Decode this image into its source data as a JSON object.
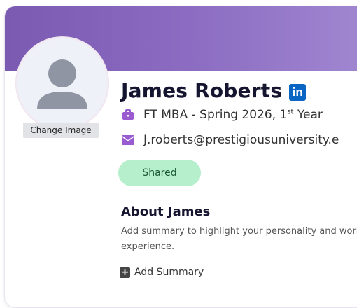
{
  "profile": {
    "name": "James Roberts",
    "linkedin_label": "in",
    "program": "FT MBA - Spring 2026, 1",
    "program_ordinal_suffix": "st",
    "program_year": " Year",
    "email": "J.roberts@prestigiousuniversity.e",
    "change_image_label": "Change Image",
    "status": "Shared"
  },
  "about": {
    "title": "About James",
    "text": "Add summary to highlight your personality and work experience.",
    "add_summary_label": "Add Summary"
  },
  "colors": {
    "banner": "#8d6ec3",
    "accent_purple": "#9a5bd0",
    "shared_bg": "#b6efcb",
    "linkedin": "#0a66c2"
  },
  "icons": {
    "avatar": "user-placeholder-icon",
    "program": "briefcase-icon",
    "email": "envelope-icon",
    "add": "plus-square-icon",
    "linkedin": "linkedin-icon"
  }
}
